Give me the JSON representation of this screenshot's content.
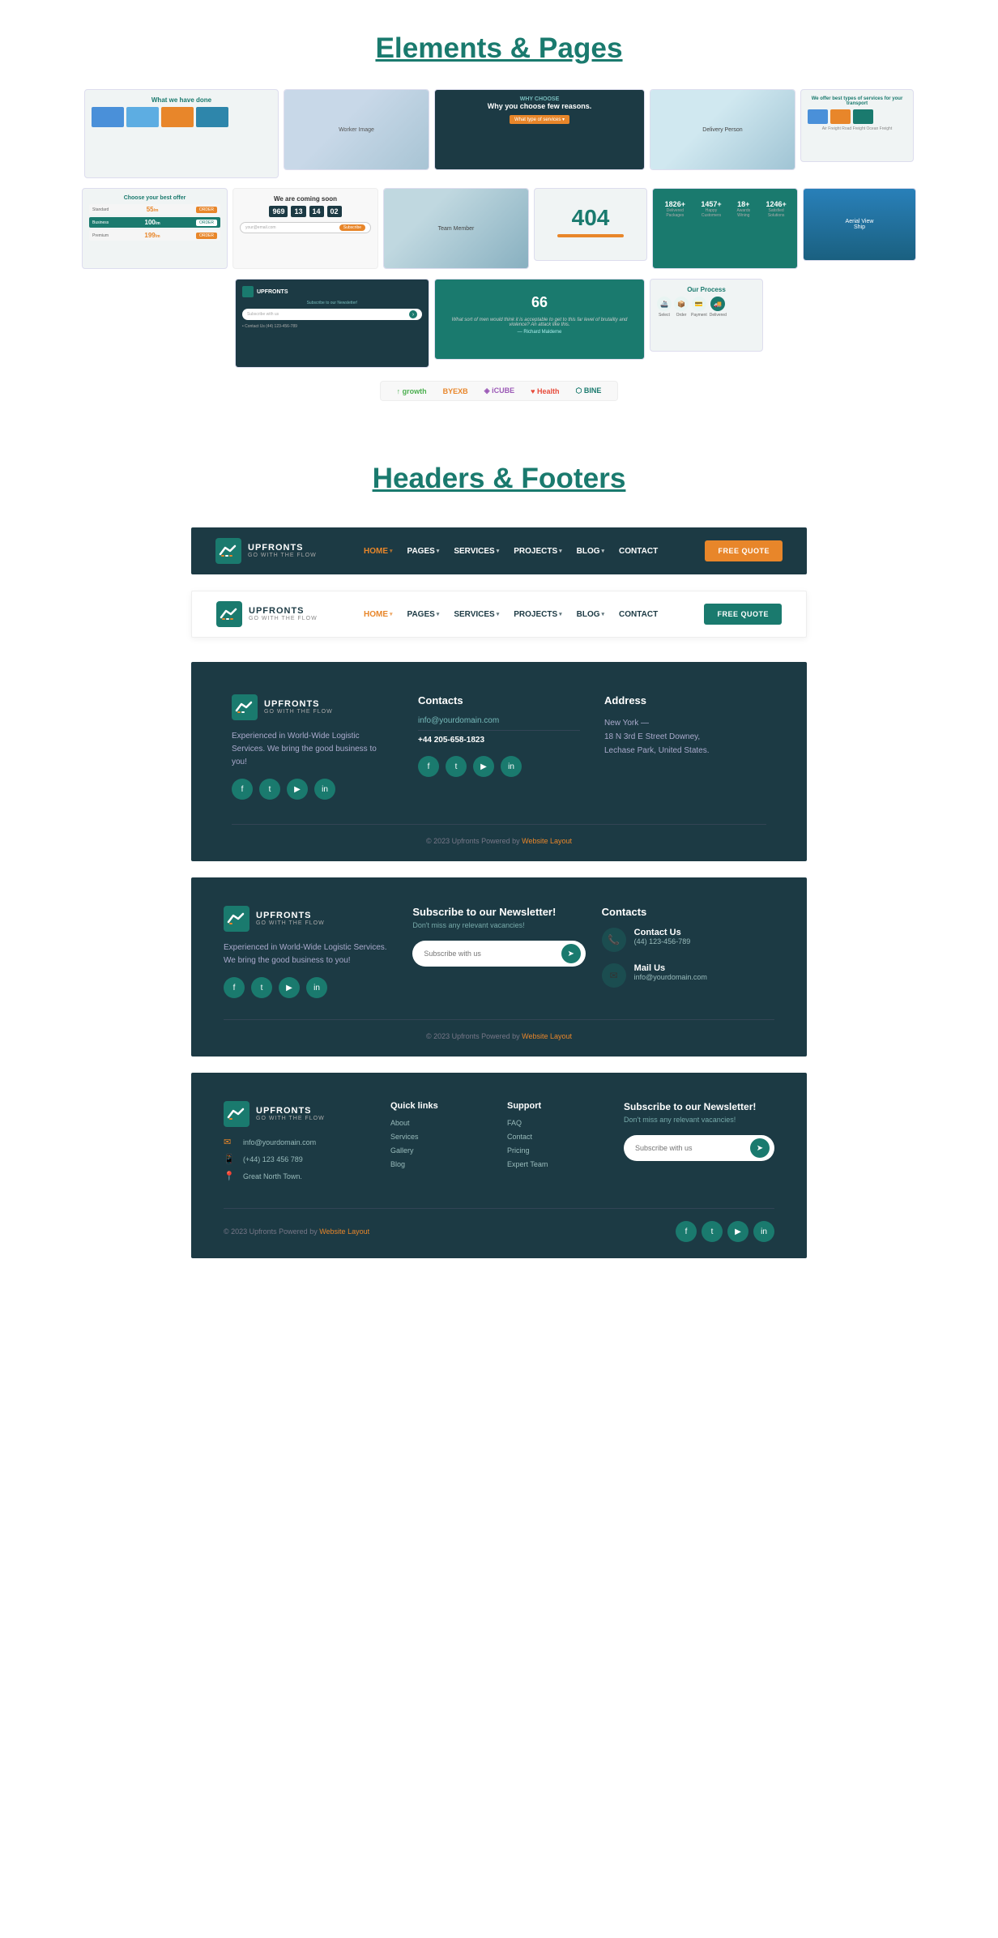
{
  "elementsSection": {
    "title": "Elements & Pages"
  },
  "headersSection": {
    "title": "Headers & Footers"
  },
  "header1": {
    "logoName": "UPFRONTS",
    "logoTagline": "GO WITH THE FLOW",
    "nav": [
      {
        "label": "HOME",
        "hasArrow": true,
        "active": true
      },
      {
        "label": "PAGES",
        "hasArrow": true,
        "active": false
      },
      {
        "label": "SERVICES",
        "hasArrow": true,
        "active": false
      },
      {
        "label": "PROJECTS",
        "hasArrow": true,
        "active": false
      },
      {
        "label": "BLOG",
        "hasArrow": true,
        "active": false
      },
      {
        "label": "CONTACT",
        "hasArrow": false,
        "active": false
      }
    ],
    "cta": "FREE QUOTE"
  },
  "header2": {
    "logoName": "UPFRONTS",
    "logoTagline": "GO WITH THE FLOW",
    "nav": [
      {
        "label": "HOME",
        "hasArrow": true,
        "active": true
      },
      {
        "label": "PAGES",
        "hasArrow": true,
        "active": false
      },
      {
        "label": "SERVICES",
        "hasArrow": true,
        "active": false
      },
      {
        "label": "PROJECTS",
        "hasArrow": true,
        "active": false
      },
      {
        "label": "BLOG",
        "hasArrow": true,
        "active": false
      },
      {
        "label": "CONTACT",
        "hasArrow": false,
        "active": false
      }
    ],
    "cta": "FREE QUOTE"
  },
  "footer1": {
    "logoName": "UPFRONTS",
    "logoTagline": "GO WITH THE FLOW",
    "description": "Experienced in World-Wide Logistic Services. We bring the good business to you!",
    "contacts": {
      "title": "Contacts",
      "email": "info@yourdomain.com",
      "phone": "+44 205-658-1823"
    },
    "address": {
      "title": "Address",
      "text": "New York — \n18 N 3rd E Street Downey,\nLechase Park, United States."
    },
    "social": [
      "f",
      "t",
      "▶",
      "in"
    ],
    "copyright": "© 2023 Upfronts Powered by",
    "copyrightLink": "Website Layout"
  },
  "footer2": {
    "logoName": "UPFRONTS",
    "logoTagline": "GO WITH THE FLOW",
    "description": "Experienced in World-Wide Logistic Services. We bring the good business to you!",
    "social": [
      "f",
      "t",
      "▶",
      "in"
    ],
    "newsletter": {
      "title": "Subscribe to our Newsletter!",
      "subtitle": "Don't miss any relevant vacancies!",
      "placeholder": "Subscribe with us"
    },
    "contacts": {
      "title": "Contacts",
      "phone": {
        "label": "Contact Us",
        "value": "(44) 123-456-789"
      },
      "mail": {
        "label": "Mail Us",
        "value": "info@yourdomain.com"
      }
    },
    "copyright": "© 2023 Upfronts Powered by",
    "copyrightLink": "Website Layout"
  },
  "footer3": {
    "logoName": "UPFRONTS",
    "logoTagline": "GO WITH THE FLOW",
    "contacts": [
      {
        "icon": "✉",
        "text": "info@yourdomain.com"
      },
      {
        "icon": "📱",
        "text": "(+44) 123 456 789"
      },
      {
        "icon": "📍",
        "text": "Great North Town."
      }
    ],
    "quickLinks": {
      "title": "Quick links",
      "items": [
        "About",
        "Services",
        "Gallery",
        "Blog"
      ]
    },
    "support": {
      "title": "Support",
      "items": [
        "FAQ",
        "Contact",
        "Pricing",
        "Expert Team"
      ]
    },
    "newsletter": {
      "title": "Subscribe to our Newsletter!",
      "subtitle": "Don't miss any relevant vacancies!",
      "placeholder": "Subscribe with us"
    },
    "social": [
      "f",
      "t",
      "▶",
      "in"
    ],
    "copyright": "© 2023 Upfronts Powered by",
    "copyrightLink": "Website Layout"
  }
}
